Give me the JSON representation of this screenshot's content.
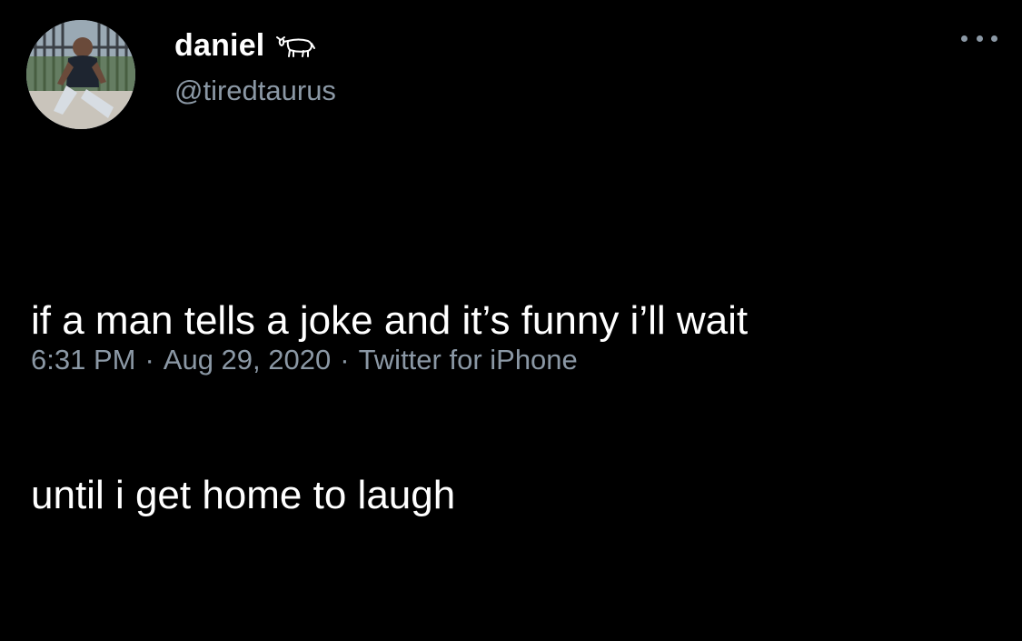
{
  "user": {
    "display_name": "daniel",
    "name_emoji": "ox-emoji",
    "handle": "@tiredtaurus",
    "avatar_icon": "profile-photo"
  },
  "tweet": {
    "text_line1": "if a man tells a joke and it’s funny i’ll wait",
    "text_line2": "until i get home to laugh"
  },
  "meta": {
    "time": "6:31 PM",
    "date": "Aug 29, 2020",
    "source": "Twitter for iPhone",
    "separator": "·"
  },
  "more_icon": "more-horizontal-icon",
  "colors": {
    "background": "#000000",
    "primary_text": "#ffffff",
    "secondary_text": "#8b98a5"
  }
}
